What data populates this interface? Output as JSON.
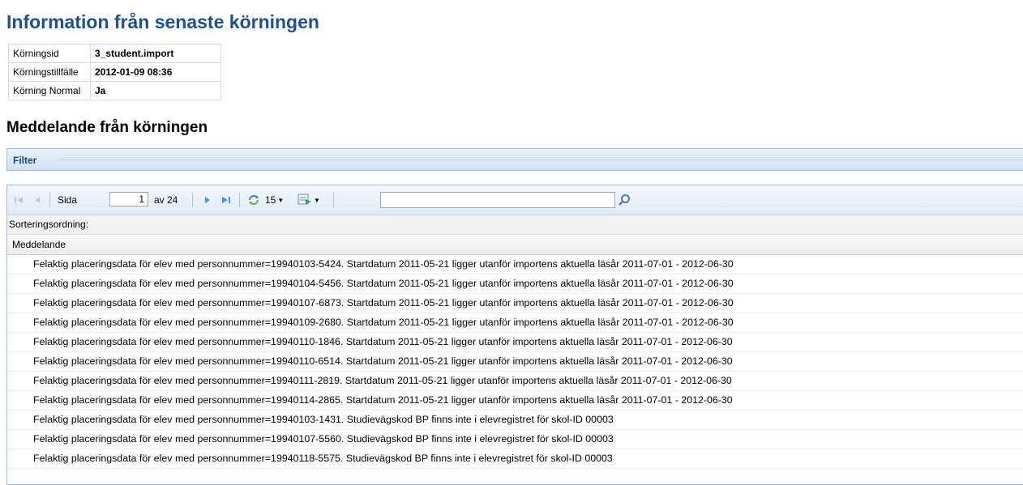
{
  "page_title": "Information från senaste körningen",
  "info": [
    {
      "label": "Körningsid",
      "value": "3_student.import"
    },
    {
      "label": "Körningstillfälle",
      "value": "2012-01-09 08:36"
    },
    {
      "label": "Körning Normal",
      "value": "Ja"
    }
  ],
  "section_title": "Meddelande från körningen",
  "filter": {
    "label": "Filter"
  },
  "toolbar": {
    "page_label": "Sida",
    "page_value": "1",
    "of_label": "av 24",
    "page_size": "15"
  },
  "grid": {
    "sort_label": "Sorteringsordning:",
    "column_header": "Meddelande",
    "rows": [
      "Felaktig placeringsdata för elev med personnummer=19940103-5424. Startdatum 2011-05-21 ligger utanför importens aktuella läsår 2011-07-01 - 2012-06-30",
      "Felaktig placeringsdata för elev med personnummer=19940104-5456. Startdatum 2011-05-21 ligger utanför importens aktuella läsår 2011-07-01 - 2012-06-30",
      "Felaktig placeringsdata för elev med personnummer=19940107-6873. Startdatum 2011-05-21 ligger utanför importens aktuella läsår 2011-07-01 - 2012-06-30",
      "Felaktig placeringsdata för elev med personnummer=19940109-2680. Startdatum 2011-05-21 ligger utanför importens aktuella läsår 2011-07-01 - 2012-06-30",
      "Felaktig placeringsdata för elev med personnummer=19940110-1846. Startdatum 2011-05-21 ligger utanför importens aktuella läsår 2011-07-01 - 2012-06-30",
      "Felaktig placeringsdata för elev med personnummer=19940110-6514. Startdatum 2011-05-21 ligger utanför importens aktuella läsår 2011-07-01 - 2012-06-30",
      "Felaktig placeringsdata för elev med personnummer=19940111-2819. Startdatum 2011-05-21 ligger utanför importens aktuella läsår 2011-07-01 - 2012-06-30",
      "Felaktig placeringsdata för elev med personnummer=19940114-2865. Startdatum 2011-05-21 ligger utanför importens aktuella läsår 2011-07-01 - 2012-06-30",
      "Felaktig placeringsdata för elev med personnummer=19940103-1431. Studievägskod BP finns inte i elevregistret för skol-ID 00003",
      "Felaktig placeringsdata för elev med personnummer=19940107-5560. Studievägskod BP finns inte i elevregistret för skol-ID 00003",
      "Felaktig placeringsdata för elev med personnummer=19940118-5575. Studievägskod BP finns inte i elevregistret för skol-ID 00003"
    ]
  },
  "icons": {
    "first": "first-page-icon",
    "prev": "prev-page-icon",
    "next": "next-page-icon",
    "last": "last-page-icon",
    "refresh": "refresh-icon",
    "export": "export-icon",
    "search": "search-icon"
  },
  "colors": {
    "title": "#1f4f91",
    "filter_text": "#15428b",
    "toolbar_icon": "#6b9bd8"
  }
}
